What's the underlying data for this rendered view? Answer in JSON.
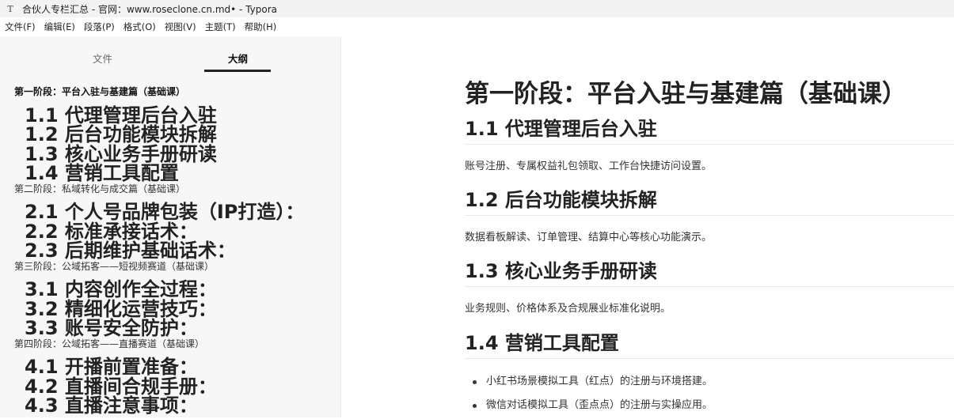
{
  "window": {
    "title": "合伙人专栏汇总 - 官网：www.roseclone.cn.md• - Typora",
    "app_icon": "typora-icon"
  },
  "menubar": {
    "items": [
      "文件(F)",
      "编辑(E)",
      "段落(P)",
      "格式(O)",
      "视图(V)",
      "主题(T)",
      "帮助(H)"
    ]
  },
  "sidebar": {
    "tabs": [
      {
        "label": "文件",
        "active": false
      },
      {
        "label": "大纲",
        "active": true
      }
    ],
    "outline": [
      {
        "text": "第一阶段：平台入驻与基建篇（基础课）",
        "level": 1,
        "active": true
      },
      {
        "text": "1.1 代理管理后台入驻",
        "level": 2
      },
      {
        "text": "1.2 后台功能模块拆解",
        "level": 2
      },
      {
        "text": "1.3 核心业务手册研读",
        "level": 2
      },
      {
        "text": "1.4 营销工具配置",
        "level": 2
      },
      {
        "text": "第二阶段：私域转化与成交篇（基础课）",
        "level": 1
      },
      {
        "text": "2.1 个人号品牌包装（IP打造）：",
        "level": 2
      },
      {
        "text": "2.2 标准承接话术：",
        "level": 2
      },
      {
        "text": "2.3 后期维护基础话术：",
        "level": 2
      },
      {
        "text": "第三阶段：公域拓客——短视频赛道（基础课）",
        "level": 1
      },
      {
        "text": "3.1 内容创作全过程：",
        "level": 2
      },
      {
        "text": "3.2 精细化运营技巧：",
        "level": 2
      },
      {
        "text": "3.3 账号安全防护：",
        "level": 2
      },
      {
        "text": "第四阶段：公域拓客——直播赛道（基础课）",
        "level": 1
      },
      {
        "text": "4.1 开播前置准备：",
        "level": 2
      },
      {
        "text": "4.2 直播间合规手册：",
        "level": 2
      },
      {
        "text": "4.3 直播注意事项：",
        "level": 2
      }
    ]
  },
  "document": {
    "h1": "第一阶段：平台入驻与基建篇（基础课）",
    "sections": [
      {
        "heading": "1.1 代理管理后台入驻",
        "paragraph": "账号注册、专属权益礼包领取、工作台快捷访问设置。"
      },
      {
        "heading": "1.2 后台功能模块拆解",
        "paragraph": "数据看板解读、订单管理、结算中心等核心功能演示。"
      },
      {
        "heading": "1.3 核心业务手册研读",
        "paragraph": "业务规则、价格体系及合规展业标准化说明。"
      },
      {
        "heading": "1.4 营销工具配置",
        "bullets": [
          "小红书场景模拟工具（红点）的注册与环境搭建。",
          "微信对话模拟工具（歪点点）的注册与实操应用。"
        ]
      }
    ]
  }
}
